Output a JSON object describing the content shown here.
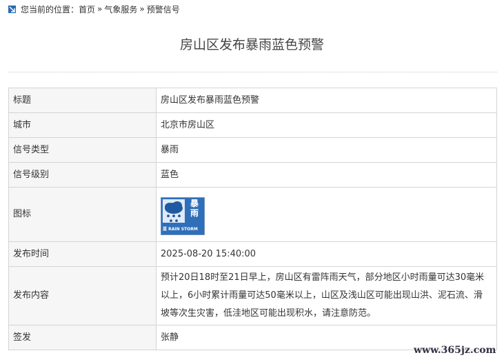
{
  "breadcrumb": {
    "prefix": "您当前的位置：",
    "items": [
      "首页",
      "气象服务",
      "预警信号"
    ],
    "separator": "»"
  },
  "page_title": "房山区发布暴雨蓝色预警",
  "table": {
    "rows": [
      {
        "label": "标题",
        "value": "房山区发布暴雨蓝色预警"
      },
      {
        "label": "城市",
        "value": "北京市房山区"
      },
      {
        "label": "信号类型",
        "value": "暴雨"
      },
      {
        "label": "信号级别",
        "value": "蓝色"
      },
      {
        "label": "图标",
        "value": ""
      },
      {
        "label": "发布时间",
        "value": "2025-08-20 15:40:00"
      },
      {
        "label": "发布内容",
        "value": "预计20日18时至21日早上，房山区有雷阵雨天气，部分地区小时雨量可达30毫米以上，6小时累计雨量可达50毫米以上，山区及浅山区可能出现山洪、泥石流、滑坡等次生灾害，低洼地区可能出现积水，请注意防范。"
      },
      {
        "label": "签发",
        "value": "张静"
      }
    ]
  },
  "warning_icon": {
    "chars": [
      "暴",
      "雨"
    ],
    "level_char": "蓝",
    "english": "RAIN STORM",
    "color": "#2f6fb9"
  },
  "watermark": "www.365jz.com"
}
